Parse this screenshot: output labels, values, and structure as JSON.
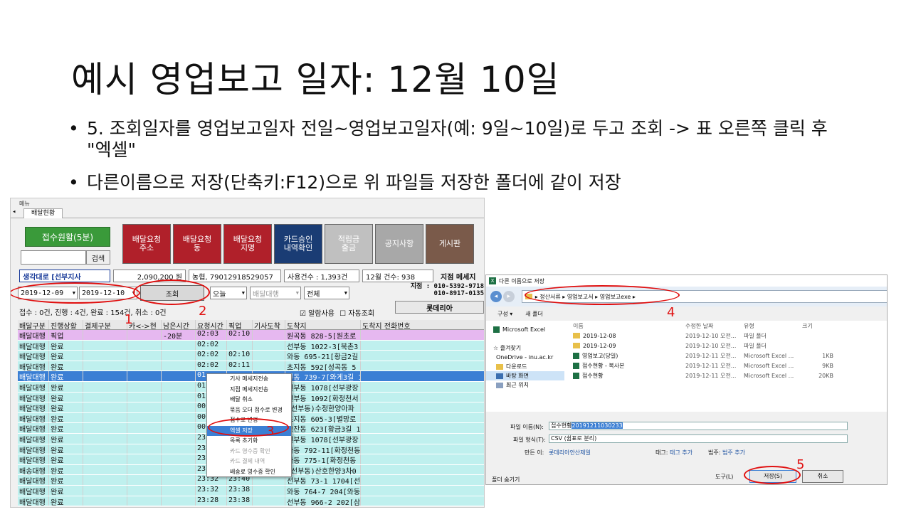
{
  "slide": {
    "title": "예시 영업보고 일자: 12월 10일",
    "bullets": [
      "5. 조회일자를 영업보고일자 전일~영업보고일자(예: 9일~10일)로 두고 조회 -> 표 오른쪽 클릭 후 \"엑셀\"",
      "다른이름으로 저장(단축키:F12)으로 위 파일들 저장한 폴더에 같이 저장"
    ],
    "bullet_symbol": "•"
  },
  "app": {
    "menu_label": "메뉴",
    "tab_label": "배달현황",
    "reception_button": "접수원활(5분)",
    "search_button": "검색",
    "buttons": [
      {
        "label": "배달요청\n주소",
        "color": "#b0202a"
      },
      {
        "label": "배달요청\n동",
        "color": "#b0202a"
      },
      {
        "label": "배달요청\n지명",
        "color": "#b0202a"
      },
      {
        "label": "카드승인\n내역확인",
        "color": "#1a3c74"
      },
      {
        "label": "적립금\n출금",
        "color": "#c0c0c0"
      },
      {
        "label": "공지사항",
        "color": "#a8a8a8"
      },
      {
        "label": "게시판",
        "color": "#7a5a4a"
      }
    ],
    "branch_select": "생각대로 [선부지사",
    "amount": "2,090,200 원",
    "account": "농협, 79012918529057",
    "usage_count": "사용건수 : 1,393건",
    "dec_count": "12월 건수: 938",
    "branch_msg": "지점 메세지",
    "date_from": "2019-12-09",
    "date_to": "2019-12-10",
    "query_button": "조회",
    "day_select": "오늘",
    "delivery_select": "배달대행",
    "all_select": "전체",
    "branch_phone_label": "지점 :",
    "branch_phones": [
      "010-5392-9718",
      "010-8917-0135"
    ],
    "lotteria_button": "롯데리아",
    "alarm_label": "알람사용",
    "auto_query_label": "자동조회",
    "status_line": "접수 : 0건, 진행 : 4건, 완료 : 154건, 취소 : 0건",
    "annotations": [
      "1",
      "2",
      "3",
      "4",
      "5"
    ],
    "grid": {
      "headers": [
        "배달구분",
        "진행상황",
        "결제구분",
        "카<->현",
        "남은시간",
        "요청시간",
        "픽업",
        "기사도착",
        "도착지",
        "도착지 전화번호"
      ],
      "rows": [
        [
          "배달대행",
          "픽업",
          "",
          "",
          "-20분",
          "02:03",
          "02:10",
          "",
          "원곡동 828-5[원초로",
          ""
        ],
        [
          "배달대행",
          "완료",
          "",
          "",
          "",
          "02:02",
          "",
          "",
          "선부동 1022-3[북촌3",
          ""
        ],
        [
          "배달대행",
          "완료",
          "",
          "",
          "",
          "02:02",
          "02:10",
          "",
          "와동 695-21[황금2길",
          ""
        ],
        [
          "배달대행",
          "완료",
          "",
          "",
          "",
          "02:02",
          "02:11",
          "",
          "초지동 592[성곡동 5",
          ""
        ],
        [
          "배달대행",
          "완료",
          "",
          "",
          "",
          "01",
          "",
          "",
          "원동 739-7[와게3길 1",
          ""
        ],
        [
          "배달대행",
          "완료",
          "",
          "",
          "",
          "01",
          "",
          "",
          "선부동 1078[선부광장",
          ""
        ],
        [
          "배달대행",
          "완료",
          "",
          "",
          "",
          "01",
          "",
          "",
          "선부동 1092[화정천서",
          ""
        ],
        [
          "배달대행",
          "완료",
          "",
          "",
          "",
          "00",
          "",
          "",
          "(선부동)수정한양아파",
          ""
        ],
        [
          "배달대행",
          "완료",
          "",
          "",
          "",
          "00",
          "",
          "",
          "초지동 605-3[별망로",
          ""
        ],
        [
          "배달대행",
          "완료",
          "",
          "",
          "",
          "00",
          "",
          "",
          "고잔동 623[황금3길 1",
          ""
        ],
        [
          "배달대행",
          "완료",
          "",
          "",
          "",
          "23",
          "",
          "",
          "선부동 1078[선부광장",
          ""
        ],
        [
          "배달대행",
          "완료",
          "",
          "",
          "",
          "23",
          "",
          "",
          "와동 792-11[화정천동",
          ""
        ],
        [
          "배달대행",
          "완료",
          "",
          "",
          "",
          "23",
          "",
          "",
          "와동 775-1[화정천동",
          ""
        ],
        [
          "배송대행",
          "완료",
          "",
          "",
          "",
          "23",
          "",
          "",
          "(선부동)산호한양3차0",
          ""
        ],
        [
          "배달대행",
          "완료",
          "",
          "",
          "",
          "23:32",
          "23:40",
          "",
          "선부동 73-1 1704[선",
          ""
        ],
        [
          "배달대행",
          "완료",
          "",
          "",
          "",
          "23:32",
          "23:38",
          "",
          "와동 764-7 204[와동",
          ""
        ],
        [
          "배달대행",
          "완료",
          "",
          "",
          "",
          "23:28",
          "23:38",
          "",
          "선부동 966-2 202[삼",
          ""
        ]
      ]
    },
    "context_menu": [
      "기사 메세지전송",
      "지점 메세지전송",
      "배달 취소",
      "묶음 오더 접수로 변경",
      "접수로 변경",
      "엑셀 저장",
      "목록 초기화",
      "카드 영수증 확인",
      "카드 결제 내역",
      "배송료 영수증 확인"
    ]
  },
  "dialog": {
    "title": "다른 이름으로 저장",
    "path": "▸ 정산서류 ▸ 영업보고서 ▸ 영업보고exe ▸",
    "organize": "구성 ▾",
    "new_folder": "새 폴더",
    "nav_items": [
      "Microsoft Excel",
      "",
      "☆ 즐겨찾기",
      "OneDrive - inu.ac.kr",
      "다운로드",
      "바탕 화면",
      "최근 위치"
    ],
    "file_headers": [
      "이름",
      "수정한 날짜",
      "유형",
      "크기"
    ],
    "files": [
      {
        "name": "2019-12-08",
        "date": "2019-12-10 오전...",
        "type": "파일 폴더",
        "size": "",
        "kind": "folder"
      },
      {
        "name": "2019-12-09",
        "date": "2019-12-10 오전...",
        "type": "파일 폴더",
        "size": "",
        "kind": "folder"
      },
      {
        "name": "영업보고(당일)",
        "date": "2019-12-11 오전...",
        "type": "Microsoft Excel ...",
        "size": "1KB",
        "kind": "xls"
      },
      {
        "name": "접수현황 - 복사본",
        "date": "2019-12-11 오전...",
        "type": "Microsoft Excel ...",
        "size": "9KB",
        "kind": "xls"
      },
      {
        "name": "접수현황",
        "date": "2019-12-11 오전...",
        "type": "Microsoft Excel ...",
        "size": "20KB",
        "kind": "xls"
      }
    ],
    "filename_label": "파일 이름(N):",
    "filename_prefix": "접수현황",
    "filename_selected": "20191211030233",
    "filetype_label": "파일 형식(T):",
    "filetype": "CSV (쉼표로 분리)",
    "author_label": "만든 이:",
    "author": "롯데리아안산제일",
    "tags_label": "태그:",
    "tags": "태그 추가",
    "category_label": "범주:",
    "category": "범주 추가",
    "hide_folders": "폴더 숨기기",
    "tools": "도구(L)",
    "save": "저장(S)",
    "cancel": "취소"
  }
}
